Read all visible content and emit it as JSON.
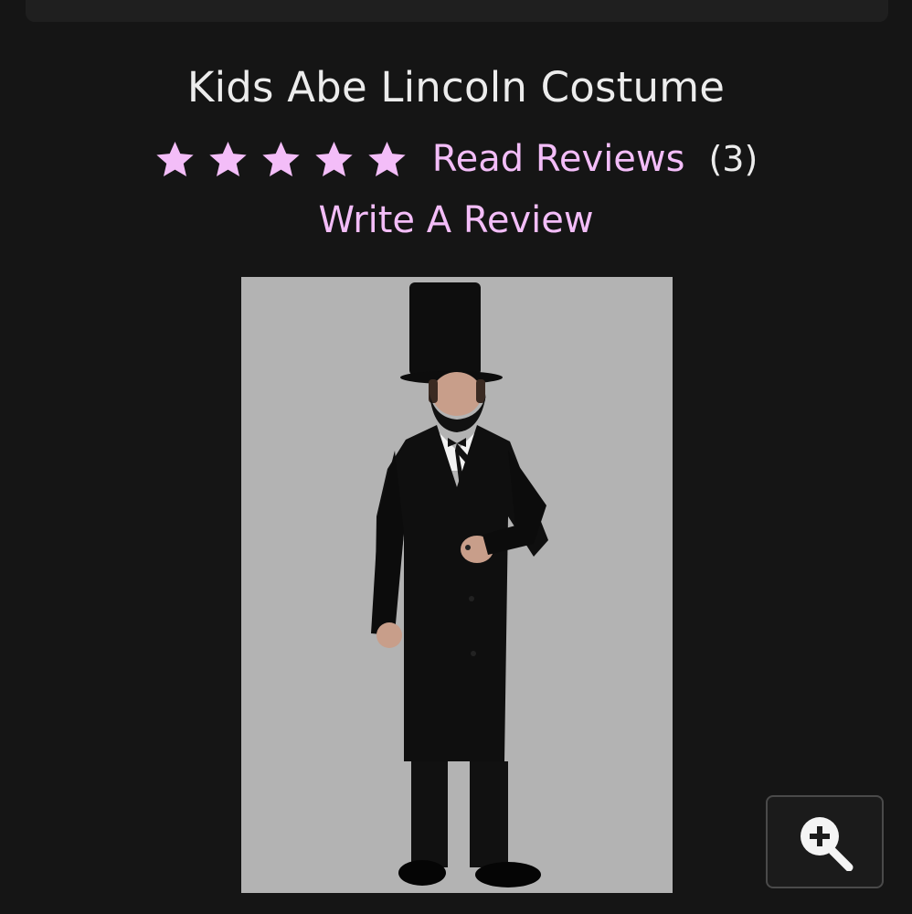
{
  "product": {
    "title": "Kids Abe Lincoln Costume",
    "rating": 5,
    "rating_max": 5,
    "read_reviews_label": "Read Reviews",
    "review_count": "(3)",
    "write_review_label": "Write A Review",
    "image_alt_subject": "boy in Abe Lincoln costume with top hat and beard"
  },
  "colors": {
    "background": "#151515",
    "accent": "#f3bdf8",
    "text": "#ececec",
    "image_background": "#b3b3b3"
  },
  "icons": {
    "star": "star-icon",
    "zoom": "zoom-in-icon"
  }
}
